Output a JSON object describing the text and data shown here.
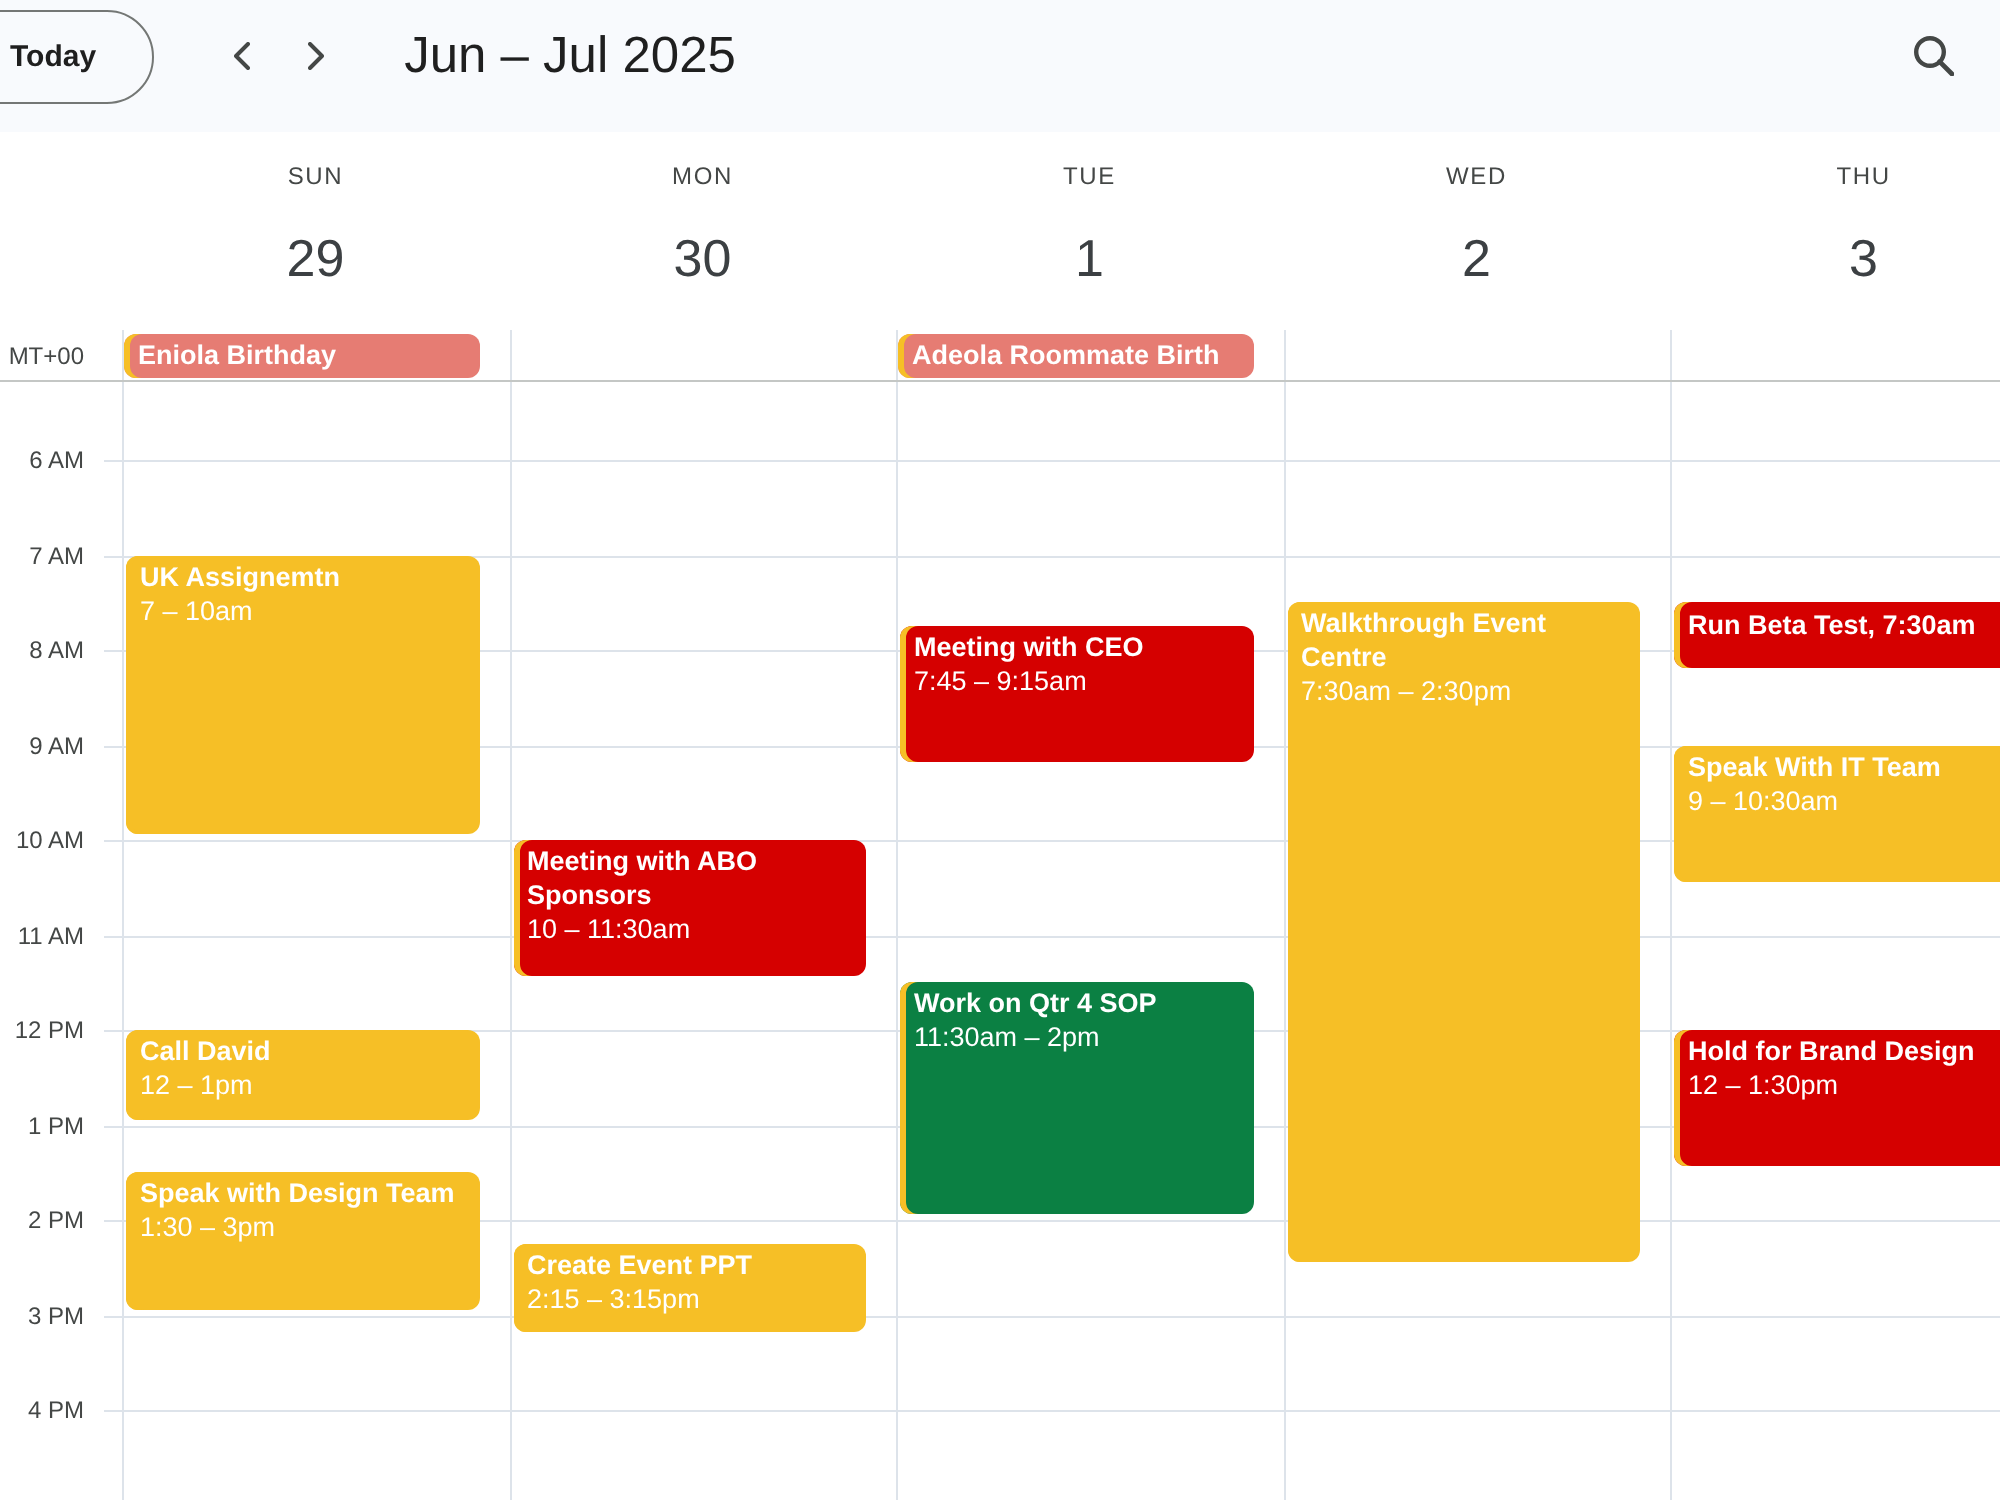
{
  "toolbar": {
    "today_button": "Today",
    "title": "Jun – Jul 2025"
  },
  "timezone_label": "MT+00",
  "hours": [
    "6 AM",
    "7 AM",
    "8 AM",
    "9 AM",
    "10 AM",
    "11 AM",
    "12 PM",
    "1 PM",
    "2 PM",
    "3 PM",
    "4 PM"
  ],
  "days": [
    {
      "weekday": "SUN",
      "date": "29",
      "all_day": [
        {
          "title": "Eniola Birthday",
          "color": "#e67c73"
        }
      ],
      "events": [
        {
          "kind": "block",
          "title": "UK Assignemtn",
          "time": "7 – 10am",
          "color": "#f6bf26"
        },
        {
          "kind": "block",
          "title": "Call David",
          "time": "12 – 1pm",
          "color": "#f6bf26"
        },
        {
          "kind": "block",
          "title": "Speak with Design Team",
          "time": "1:30 – 3pm",
          "color": "#f6bf26"
        }
      ]
    },
    {
      "weekday": "MON",
      "date": "30",
      "events": [
        {
          "kind": "block",
          "title": "Meeting with ABO Sponsors",
          "time": "10 – 11:30am",
          "color": "#d50000"
        },
        {
          "kind": "block",
          "title": "Create Event PPT",
          "time": "2:15 – 3:15pm",
          "color": "#f6bf26"
        }
      ]
    },
    {
      "weekday": "TUE",
      "date": "1",
      "all_day": [
        {
          "title": "Adeola Roommate Birth",
          "color": "#e67c73"
        }
      ],
      "events": [
        {
          "kind": "block",
          "title": "Meeting with CEO",
          "time": "7:45 – 9:15am",
          "color": "#d50000"
        },
        {
          "kind": "block",
          "title": "Work on Qtr 4 SOP",
          "time": "11:30am – 2pm",
          "color": "#0b8043"
        }
      ]
    },
    {
      "weekday": "WED",
      "date": "2",
      "events": [
        {
          "kind": "block",
          "title": "Walkthrough Event Centre",
          "time": "7:30am – 2:30pm",
          "color": "#f6bf26"
        }
      ]
    },
    {
      "weekday": "THU",
      "date": "3",
      "events": [
        {
          "kind": "compact",
          "title": "Run Beta Test, 7:30am",
          "color": "#d50000"
        },
        {
          "kind": "block",
          "title": "Speak With IT Team",
          "time": "9 – 10:30am",
          "color": "#f6bf26"
        },
        {
          "kind": "block",
          "title": "Hold for Brand Design",
          "time": "12 – 1:30pm",
          "color": "#d50000"
        }
      ]
    }
  ]
}
